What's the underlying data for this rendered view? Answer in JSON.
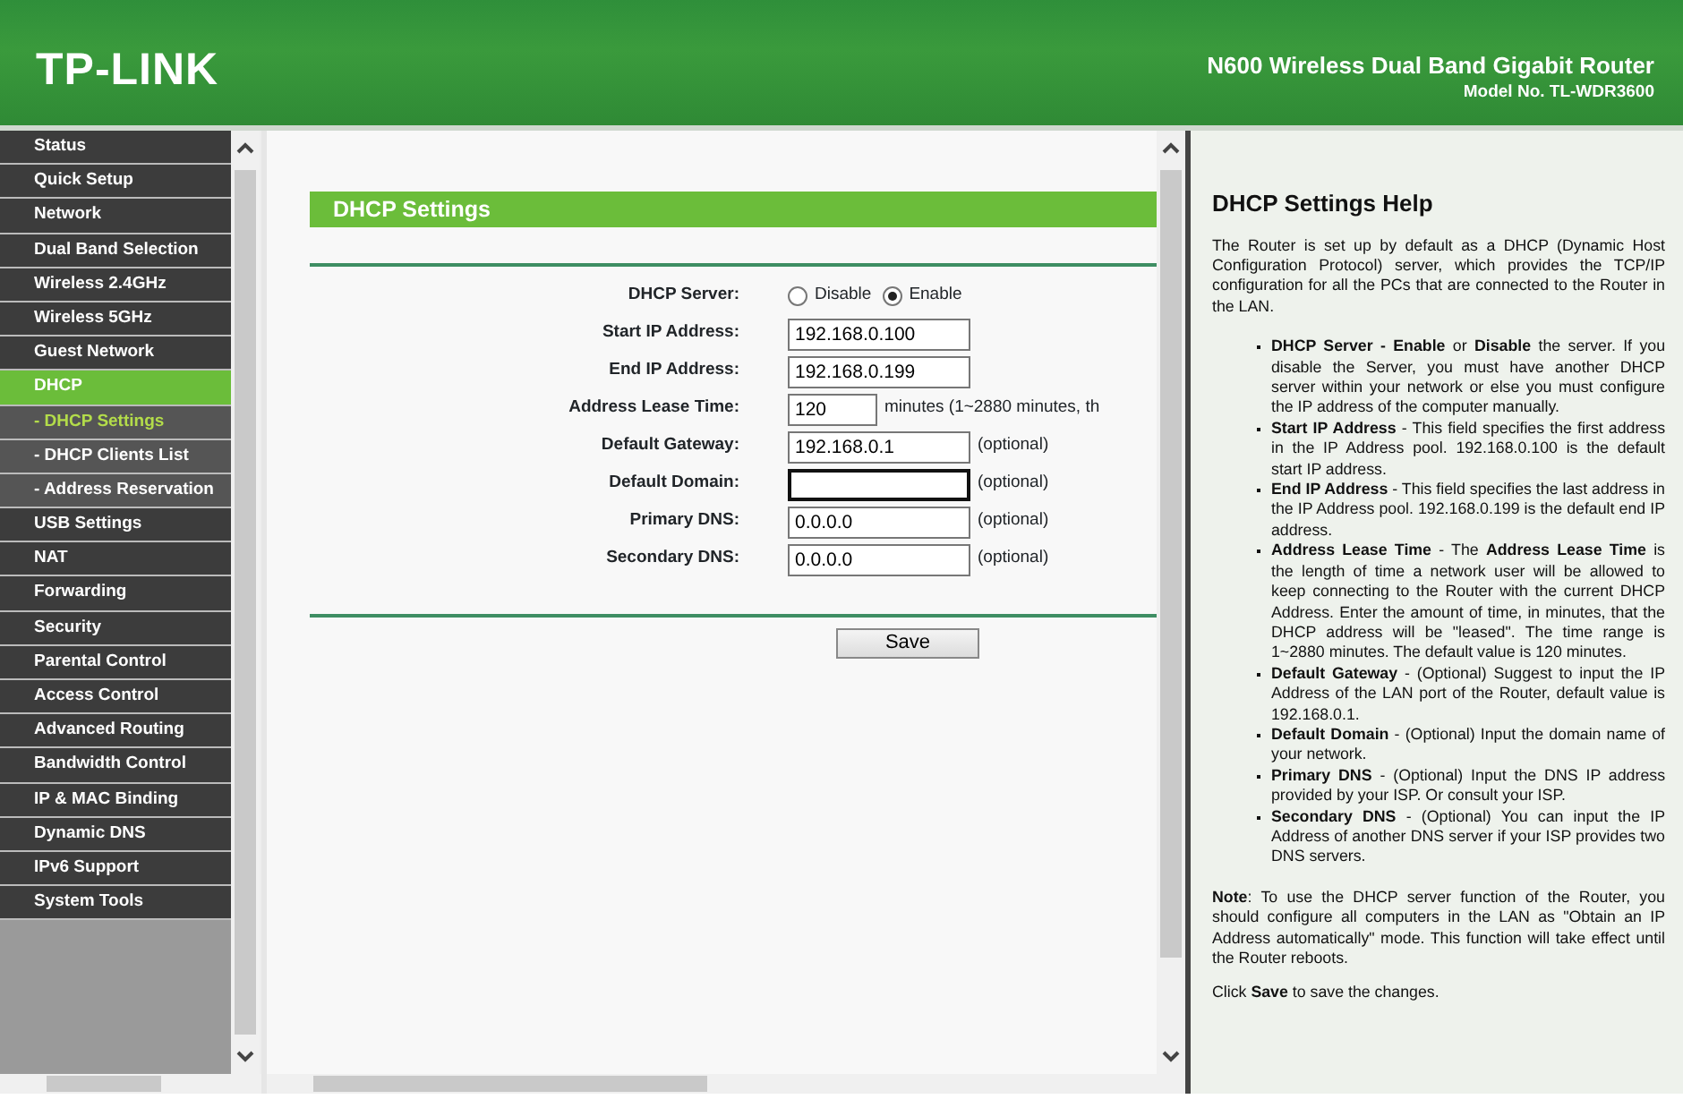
{
  "header": {
    "brand": "TP-LINK",
    "product": "N600 Wireless Dual Band Gigabit Router",
    "model": "Model No. TL-WDR3600"
  },
  "menu": [
    {
      "label": "Status",
      "selected": false
    },
    {
      "label": "Quick Setup",
      "selected": false
    },
    {
      "label": "Network",
      "selected": false
    },
    {
      "label": "Dual Band Selection",
      "selected": false
    },
    {
      "label": "Wireless 2.4GHz",
      "selected": false
    },
    {
      "label": "Wireless 5GHz",
      "selected": false
    },
    {
      "label": "Guest Network",
      "selected": false
    },
    {
      "label": "DHCP",
      "selected": true,
      "children": [
        {
          "label": "- DHCP Settings",
          "selected": true
        },
        {
          "label": "- DHCP Clients List",
          "selected": false
        },
        {
          "label": "- Address Reservation",
          "selected": false
        }
      ]
    },
    {
      "label": "USB Settings",
      "selected": false
    },
    {
      "label": "NAT",
      "selected": false
    },
    {
      "label": "Forwarding",
      "selected": false
    },
    {
      "label": "Security",
      "selected": false
    },
    {
      "label": "Parental Control",
      "selected": false
    },
    {
      "label": "Access Control",
      "selected": false
    },
    {
      "label": "Advanced Routing",
      "selected": false
    },
    {
      "label": "Bandwidth Control",
      "selected": false
    },
    {
      "label": "IP & MAC Binding",
      "selected": false
    },
    {
      "label": "Dynamic DNS",
      "selected": false
    },
    {
      "label": "IPv6 Support",
      "selected": false
    },
    {
      "label": "System Tools",
      "selected": false
    }
  ],
  "form": {
    "title": "DHCP Settings",
    "fields": [
      {
        "kind": "radio",
        "label": "DHCP Server:",
        "options": [
          {
            "label": "Disable",
            "selected": false
          },
          {
            "label": "Enable",
            "selected": true
          }
        ]
      },
      {
        "kind": "input",
        "label": "Start IP Address:",
        "value": "192.168.0.100",
        "focused": false
      },
      {
        "kind": "input",
        "label": "End IP Address:",
        "value": "192.168.0.199",
        "focused": false
      },
      {
        "kind": "short-input",
        "label": "Address Lease Time:",
        "value": "120",
        "focused": false,
        "note": "minutes (1~2880 minutes, th"
      },
      {
        "kind": "input",
        "label": "Default Gateway:",
        "value": "192.168.0.1",
        "focused": false,
        "note": "(optional)"
      },
      {
        "kind": "input",
        "label": "Default Domain:",
        "focused": true,
        "note": "(optional)"
      },
      {
        "kind": "input",
        "label": "Primary DNS:",
        "value": "0.0.0.0",
        "focused": false,
        "note": "(optional)"
      },
      {
        "kind": "input",
        "label": "Secondary DNS:",
        "value": "0.0.0.0",
        "focused": false,
        "note": "(optional)"
      }
    ],
    "save_button": "Save"
  },
  "help": {
    "title": "DHCP Settings Help",
    "intro": "The Router is set up by default as a DHCP (Dynamic Host Configuration Protocol) server, which provides the TCP/IP configuration for all the PCs that are connected to the Router in the LAN.",
    "items": [
      "**DHCP Server - Enable** or **Disable** the server. If you disable the Server, you must have another DHCP server within your network or else you must configure the IP address of the computer manually.",
      "**Start IP Address** - This field specifies the first address in the IP Address pool. 192.168.0.100 is the default start IP address.",
      "**End IP Address** - This field specifies the last address in the IP Address pool. 192.168.0.199 is the default end IP address.",
      "**Address Lease Time** - The **Address Lease Time** is the length of time a network user will be allowed to keep connecting to the Router with the current DHCP Address. Enter the amount of time, in minutes, that the DHCP address will be \"leased\". The time range is 1~2880 minutes. The default value is 120 minutes.",
      "**Default Gateway** - (Optional) Suggest to input the IP Address of the LAN port of the Router, default value is 192.168.0.1.",
      "**Default Domain** - (Optional) Input the domain name of your network.",
      "**Primary DNS** - (Optional) Input the DNS IP address provided by your ISP. Or consult your ISP.",
      "**Secondary DNS** - (Optional) You can input the IP Address of another DNS server if your ISP provides two DNS servers."
    ],
    "note": "**Note**: To use the DHCP server function of the Router, you should configure all computers in the LAN as \"Obtain an IP Address automatically\" mode. This function will take effect until the Router reboots.",
    "save_hint": "Click **Save** to save the changes."
  }
}
